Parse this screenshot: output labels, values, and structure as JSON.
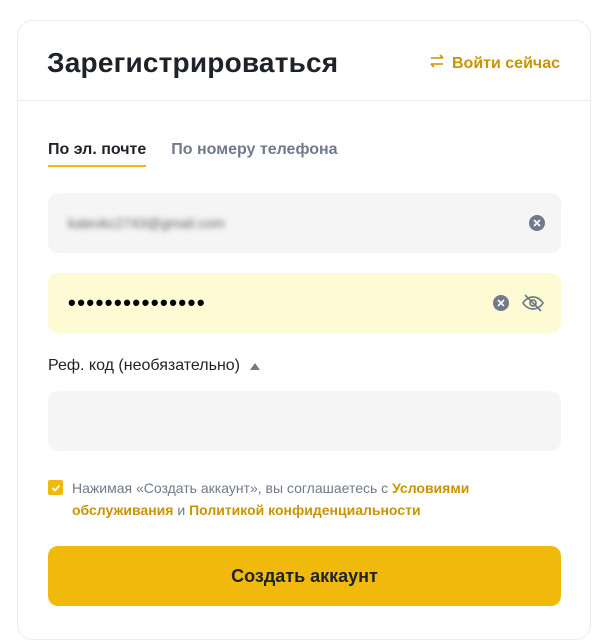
{
  "header": {
    "title": "Зарегистрироваться",
    "login_link": "Войти сейчас"
  },
  "tabs": [
    {
      "label": "По эл. почте",
      "active": true
    },
    {
      "label": "По номеру телефона",
      "active": false
    }
  ],
  "email_field": {
    "value": "katevkc2743@gmail.com"
  },
  "password_field": {
    "value": "•••••••••••••••"
  },
  "referral": {
    "label": "Реф. код (необязательно)",
    "value": ""
  },
  "agreement": {
    "checked": true,
    "text_before": "Нажимая «Создать аккаунт», вы соглашаетесь с ",
    "terms_link": "Условиями обслуживания",
    "text_and": " и ",
    "privacy_link": "Политикой конфиденциальности"
  },
  "submit_label": "Создать аккаунт",
  "colors": {
    "accent": "#f0b90b",
    "link": "#c99400",
    "password_bg": "#fefad3",
    "field_bg": "#f5f5f5"
  }
}
